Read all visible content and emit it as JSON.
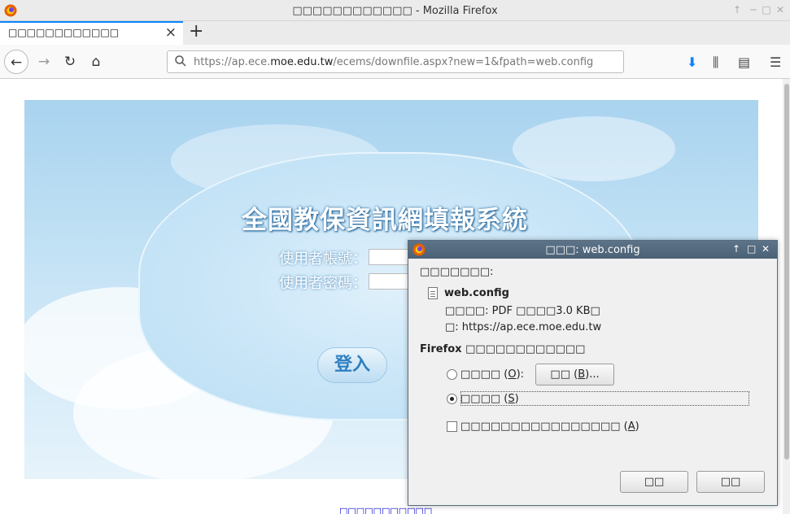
{
  "window": {
    "title": "□□□□□□□□□□□□ - Mozilla Firefox",
    "controls": {
      "up": "↑",
      "min": "─",
      "max": "□",
      "close": "✕"
    }
  },
  "tab": {
    "title": "□□□□□□□□□□□□",
    "close": "×",
    "new_tab": "+"
  },
  "nav": {
    "back": "←",
    "forward": "→",
    "reload": "↻",
    "home": "⌂",
    "url_prefix": "https://ap.ece.",
    "url_domain": "moe.edu.tw",
    "url_suffix": "/ecems/downfile.aspx?new=1&fpath=web.config",
    "search_icon": "🔍",
    "download_icon": "⬇",
    "library_icon": "⫼",
    "sidebar_icon": "▤",
    "menu_icon": "☰"
  },
  "page": {
    "system_title": "全國教保資訊網填報系統",
    "username_label": "使用者帳號：",
    "password_label": "使用者密碼：",
    "login_button": "登入",
    "footer_link": "□□□□□□□□□□□"
  },
  "dialog": {
    "title": "□□□: web.config",
    "controls": {
      "up": "↑",
      "max": "□",
      "close": "✕"
    },
    "intro": "□□□□□□□:",
    "filename": "web.config",
    "type_line": "□□□□: PDF □□□□3.0 KB□",
    "from_line": "□: https://ap.ece.moe.edu.tw",
    "question": "Firefox □□□□□□□□□□□□",
    "open_with_label": "□□□□",
    "open_with_key": "O",
    "browse_label": "□□",
    "browse_key": "B",
    "save_label": "□□□□",
    "save_key": "S",
    "remember_label": "□□□□□□□□□□□□□□□□",
    "remember_key": "A",
    "ok_button": "□□",
    "cancel_button": "□□",
    "selected_option": "save"
  }
}
